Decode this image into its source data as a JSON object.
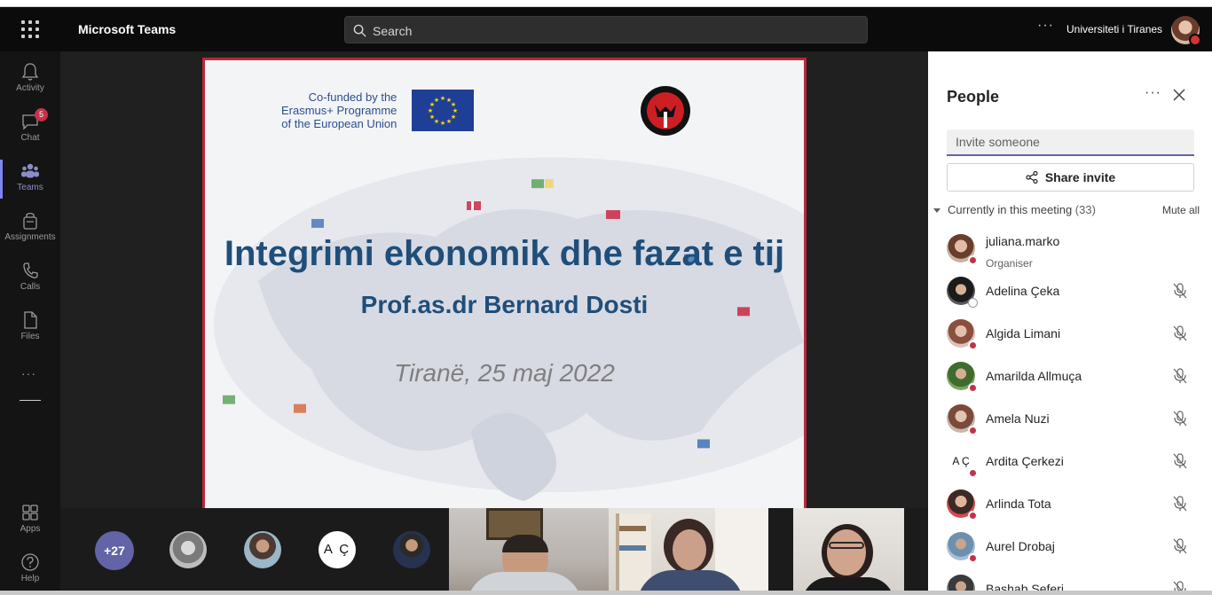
{
  "app": {
    "title": "Microsoft Teams",
    "tenant": "Universiteti i Tiranes"
  },
  "search": {
    "placeholder": "Search"
  },
  "rail": [
    {
      "label": "Activity",
      "icon": "bell-icon"
    },
    {
      "label": "Chat",
      "icon": "chat-icon",
      "badge": "5"
    },
    {
      "label": "Teams",
      "icon": "teams-icon",
      "active": true
    },
    {
      "label": "Assignments",
      "icon": "assignments-icon"
    },
    {
      "label": "Calls",
      "icon": "phone-icon"
    },
    {
      "label": "Files",
      "icon": "file-icon"
    },
    {
      "label": "Apps",
      "icon": "apps-icon"
    },
    {
      "label": "Help",
      "icon": "help-icon"
    }
  ],
  "slide": {
    "cofunded": [
      "Co-funded by the",
      "Erasmus+ Programme",
      "of the European Union"
    ],
    "title": "Integrimi ekonomik dhe fazat e tij",
    "presenter": "Prof.as.dr Bernard Dosti",
    "date": "Tiranë, 25 maj 2022",
    "colors": {
      "title": "#1f4e79",
      "border": "#b62a3a"
    }
  },
  "tray": {
    "more_count": "+27",
    "initials_avatar": "A Ç"
  },
  "people": {
    "title": "People",
    "invite_placeholder": "Invite someone",
    "share_label": "Share invite",
    "section_label": "Currently in this meeting",
    "section_count": "(33)",
    "mute_all": "Mute all",
    "organiser_role": "Organiser",
    "list": [
      {
        "name": "juliana.marko",
        "role": "Organiser"
      },
      {
        "name": "Adelina Çeka"
      },
      {
        "name": "Algida Limani"
      },
      {
        "name": "Amarilda Allmuça"
      },
      {
        "name": "Amela Nuzi"
      },
      {
        "name": "Ardita Çerkezi",
        "initials": "A Ç"
      },
      {
        "name": "Arlinda Tota"
      },
      {
        "name": "Aurel Drobaj"
      },
      {
        "name": "Bashab Seferi"
      }
    ]
  },
  "colors": {
    "accent": "#6264a7",
    "presence_busy": "#c4314b",
    "topbar": "#0b0b0b"
  }
}
